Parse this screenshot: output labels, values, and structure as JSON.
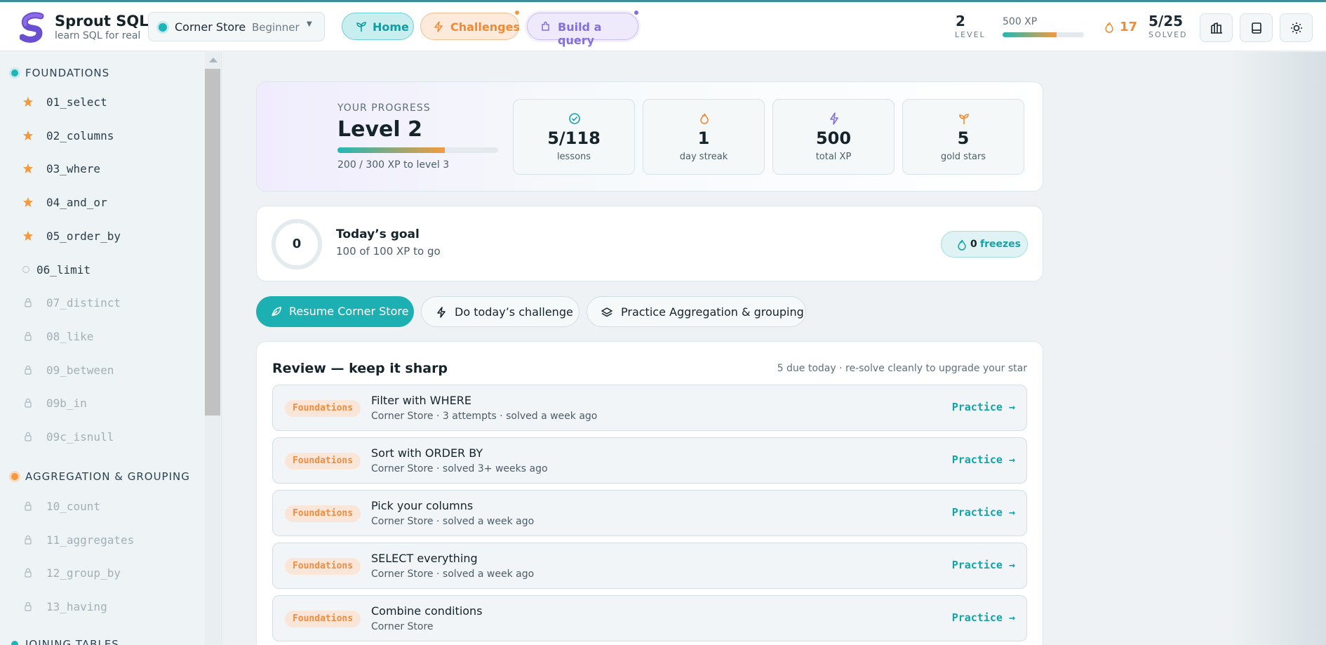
{
  "brand": {
    "name": "Sprout SQL",
    "tagline": "learn SQL for real"
  },
  "dataset": {
    "name": "Corner Store",
    "level": "Beginner"
  },
  "nav": {
    "home": "Home",
    "challenges": "Challenges",
    "build": "Build a query"
  },
  "stats": {
    "level": "2",
    "level_label": "LEVEL",
    "xp_label": "500 XP",
    "xp_fraction": 0.66,
    "streak": "17",
    "solved": "5/25",
    "solved_label": "SOLVED"
  },
  "colors": {
    "accent": "#1cb0b2",
    "orange": "#f08a35",
    "purple": "#8370d8"
  },
  "sidebar": {
    "sections": [
      {
        "label": "FOUNDATIONS"
      },
      {
        "label": "AGGREGATION & GROUPING"
      },
      {
        "label": "JOINING TABLES"
      }
    ],
    "foundations": [
      "01_select",
      "02_columns",
      "03_where",
      "04_and_or",
      "05_order_by",
      "06_limit",
      "07_distinct",
      "08_like",
      "09_between",
      "09b_in",
      "09c_isnull"
    ],
    "aggregation": [
      "10_count",
      "11_aggregates",
      "12_group_by",
      "13_having"
    ]
  },
  "progress": {
    "label": "YOUR PROGRESS",
    "level": "Level 2",
    "bar_fraction": 0.667,
    "sub": "200 / 300 XP to level 3",
    "tiles": [
      {
        "value": "5/118",
        "label": "lessons"
      },
      {
        "value": "1",
        "label": "day streak"
      },
      {
        "value": "500",
        "label": "total XP"
      },
      {
        "value": "5",
        "label": "gold stars"
      }
    ]
  },
  "goal": {
    "ring": "0",
    "title": "Today’s goal",
    "sub": "100 of 100 XP to go",
    "freeze_count": "0",
    "freeze_label": "freezes"
  },
  "actions": {
    "resume": "Resume Corner Store",
    "today": "Do today’s challenge",
    "practice": "Practice Aggregation & grouping"
  },
  "review": {
    "title": "Review — keep it sharp",
    "note": "5 due today · re-solve cleanly to upgrade your star",
    "items": [
      {
        "tag": "Foundations",
        "title": "Filter with WHERE",
        "sub": "Corner Store · 3 attempts · solved a week ago",
        "link": "Practice →"
      },
      {
        "tag": "Foundations",
        "title": "Sort with ORDER BY",
        "sub": "Corner Store · solved 3+ weeks ago",
        "link": "Practice →"
      },
      {
        "tag": "Foundations",
        "title": "Pick your columns",
        "sub": "Corner Store · solved a week ago",
        "link": "Practice →"
      },
      {
        "tag": "Foundations",
        "title": "SELECT everything",
        "sub": "Corner Store · solved a week ago",
        "link": "Practice →"
      },
      {
        "tag": "Foundations",
        "title": "Combine conditions",
        "sub": "Corner Store",
        "link": "Practice →"
      }
    ]
  }
}
